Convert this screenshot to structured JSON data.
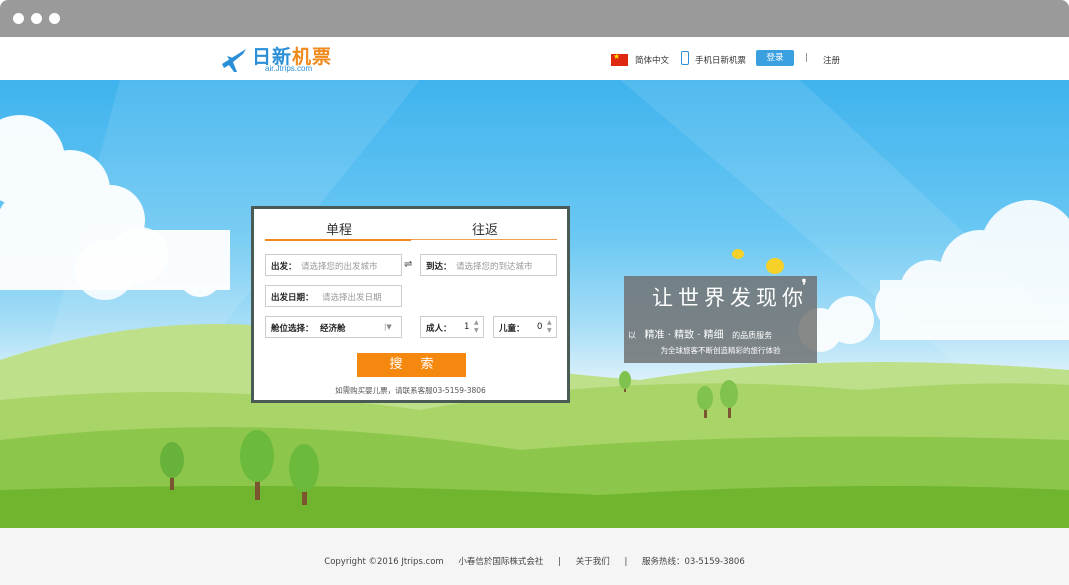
{
  "header": {
    "logo_title_part1": "日新",
    "logo_title_part2": "机票",
    "logo_subtitle": "air.Jtrips.com",
    "language": "简体中文",
    "mobile_label": "手机日新机票",
    "login_label": "登录",
    "separator": "|",
    "register_label": "注册"
  },
  "search": {
    "tabs": [
      {
        "label": "单程",
        "active": true
      },
      {
        "label": "往返",
        "active": false
      }
    ],
    "departure_label": "出发：",
    "departure_placeholder": "请选择您的出发城市",
    "arrival_label": "到达：",
    "arrival_placeholder": "请选择您的到达城市",
    "date_label": "出发日期：",
    "date_placeholder": "请选择出发日期",
    "cabin_label": "舱位选择：",
    "cabin_value": "经济舱",
    "adult_label": "成人：",
    "adult_value": "1",
    "child_label": "儿童：",
    "child_value": "0",
    "button_label": "搜索",
    "note": "如需购买婴儿票，请联系客服03-5159-3806"
  },
  "slogan": {
    "headline": "让世界发现你",
    "quote_mark": "❜",
    "line1_prefix": "以",
    "line1_words": "精准 · 精致 · 精细",
    "line1_suffix": "的品质服务",
    "line2": "为全球旅客不断创造精彩的旅行体验"
  },
  "footer": {
    "copyright": "Copyright ©2016 Jtrips.com",
    "company": "小春信於国际株式会社",
    "sep": "|",
    "about": "关于我们",
    "hotline": "服务热线：03-5159-3806"
  },
  "colors": {
    "accent_orange": "#f5880f",
    "brand_blue": "#2a8fd6",
    "login_blue": "#3aa0e0"
  }
}
